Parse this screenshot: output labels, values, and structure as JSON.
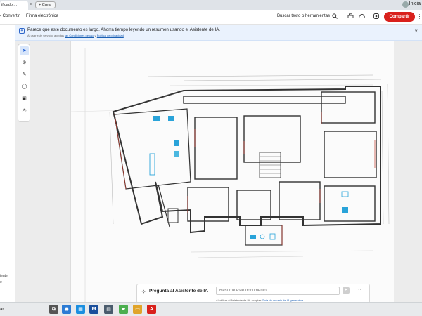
{
  "window": {
    "tab_title": "ificado ...",
    "tab_close": "×",
    "new_tab_label": "+ Crear",
    "profile_text": "Inicia"
  },
  "toolbar": {
    "convert_label": "Convertir",
    "sign_label": "Firma electrónica",
    "search_label": "Buscar texto o herramientas",
    "share_label": "Compartir"
  },
  "banner": {
    "message": "Parece que este documento es largo. Ahorra tiempo leyendo un resumen usando el Asistente de IA.",
    "sub_prefix": "Al usar este servicio, aceptas",
    "terms_link": "las Condiciones de uso",
    "sub_join": "y",
    "privacy_link": "Política de privacidad"
  },
  "left_strip": {
    "text1": "iente",
    "text2": "e"
  },
  "ai_assistant": {
    "title": "Pregunta al Asistente de IA",
    "input_placeholder": "Resume este documento",
    "disclaimer_prefix": "Al utilizar el Asistente de IA, aceptas",
    "disclaimer_link": "Guía de usuario de IA generativa."
  },
  "taskbar": {
    "left_text": "ar."
  },
  "colors": {
    "accent": "#d9211c",
    "link": "#1a5fb4",
    "banner_bg": "#eaf2fd"
  }
}
